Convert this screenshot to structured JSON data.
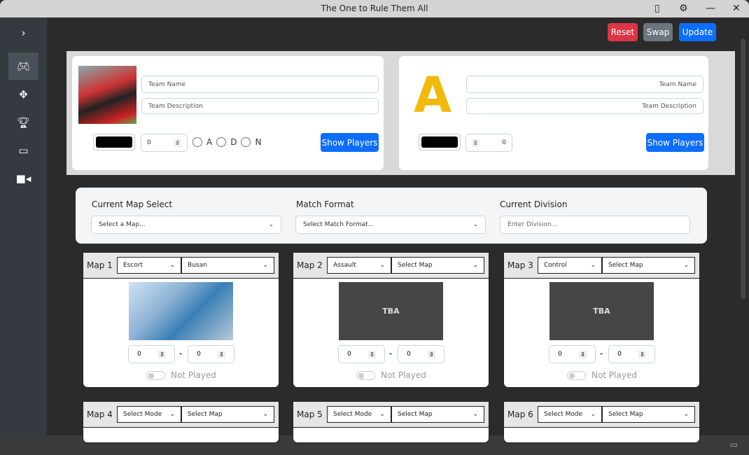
{
  "window": {
    "title": "The One to Rule Them All"
  },
  "toolbar": {
    "reset": "Reset",
    "swap": "Swap",
    "update": "Update"
  },
  "colors": {
    "reset": "#dc3545",
    "swap": "#6c757d",
    "update": "#0d6efd"
  },
  "team1": {
    "name_placeholder": "Team Name",
    "desc_placeholder": "Team Description",
    "score": "0",
    "radios": [
      "A",
      "D",
      "N"
    ],
    "show_players": "Show Players"
  },
  "team2": {
    "name_placeholder": "Team Name",
    "desc_placeholder": "Team Description",
    "score": "0",
    "show_players": "Show Players"
  },
  "match": {
    "map_label": "Current Map Select",
    "map_value": "Select a Map...",
    "format_label": "Match Format",
    "format_value": "Select Match Format...",
    "division_label": "Current Division",
    "division_placeholder": "Enter Division..."
  },
  "maps": [
    {
      "label": "Map 1",
      "mode": "Escort",
      "map": "Busan",
      "image": "busan",
      "score1": "0",
      "score2": "0",
      "status": "Not Played"
    },
    {
      "label": "Map 2",
      "mode": "Assault",
      "map": "Select Map",
      "image": "TBA",
      "score1": "0",
      "score2": "0",
      "status": "Not Played"
    },
    {
      "label": "Map 3",
      "mode": "Control",
      "map": "Select Map",
      "image": "TBA",
      "score1": "0",
      "score2": "0",
      "status": "Not Played"
    },
    {
      "label": "Map 4",
      "mode": "Select Mode",
      "map": "Select Map"
    },
    {
      "label": "Map 5",
      "mode": "Select Mode",
      "map": "Select Map"
    },
    {
      "label": "Map 6",
      "mode": "Select Mode",
      "map": "Select Map"
    }
  ]
}
